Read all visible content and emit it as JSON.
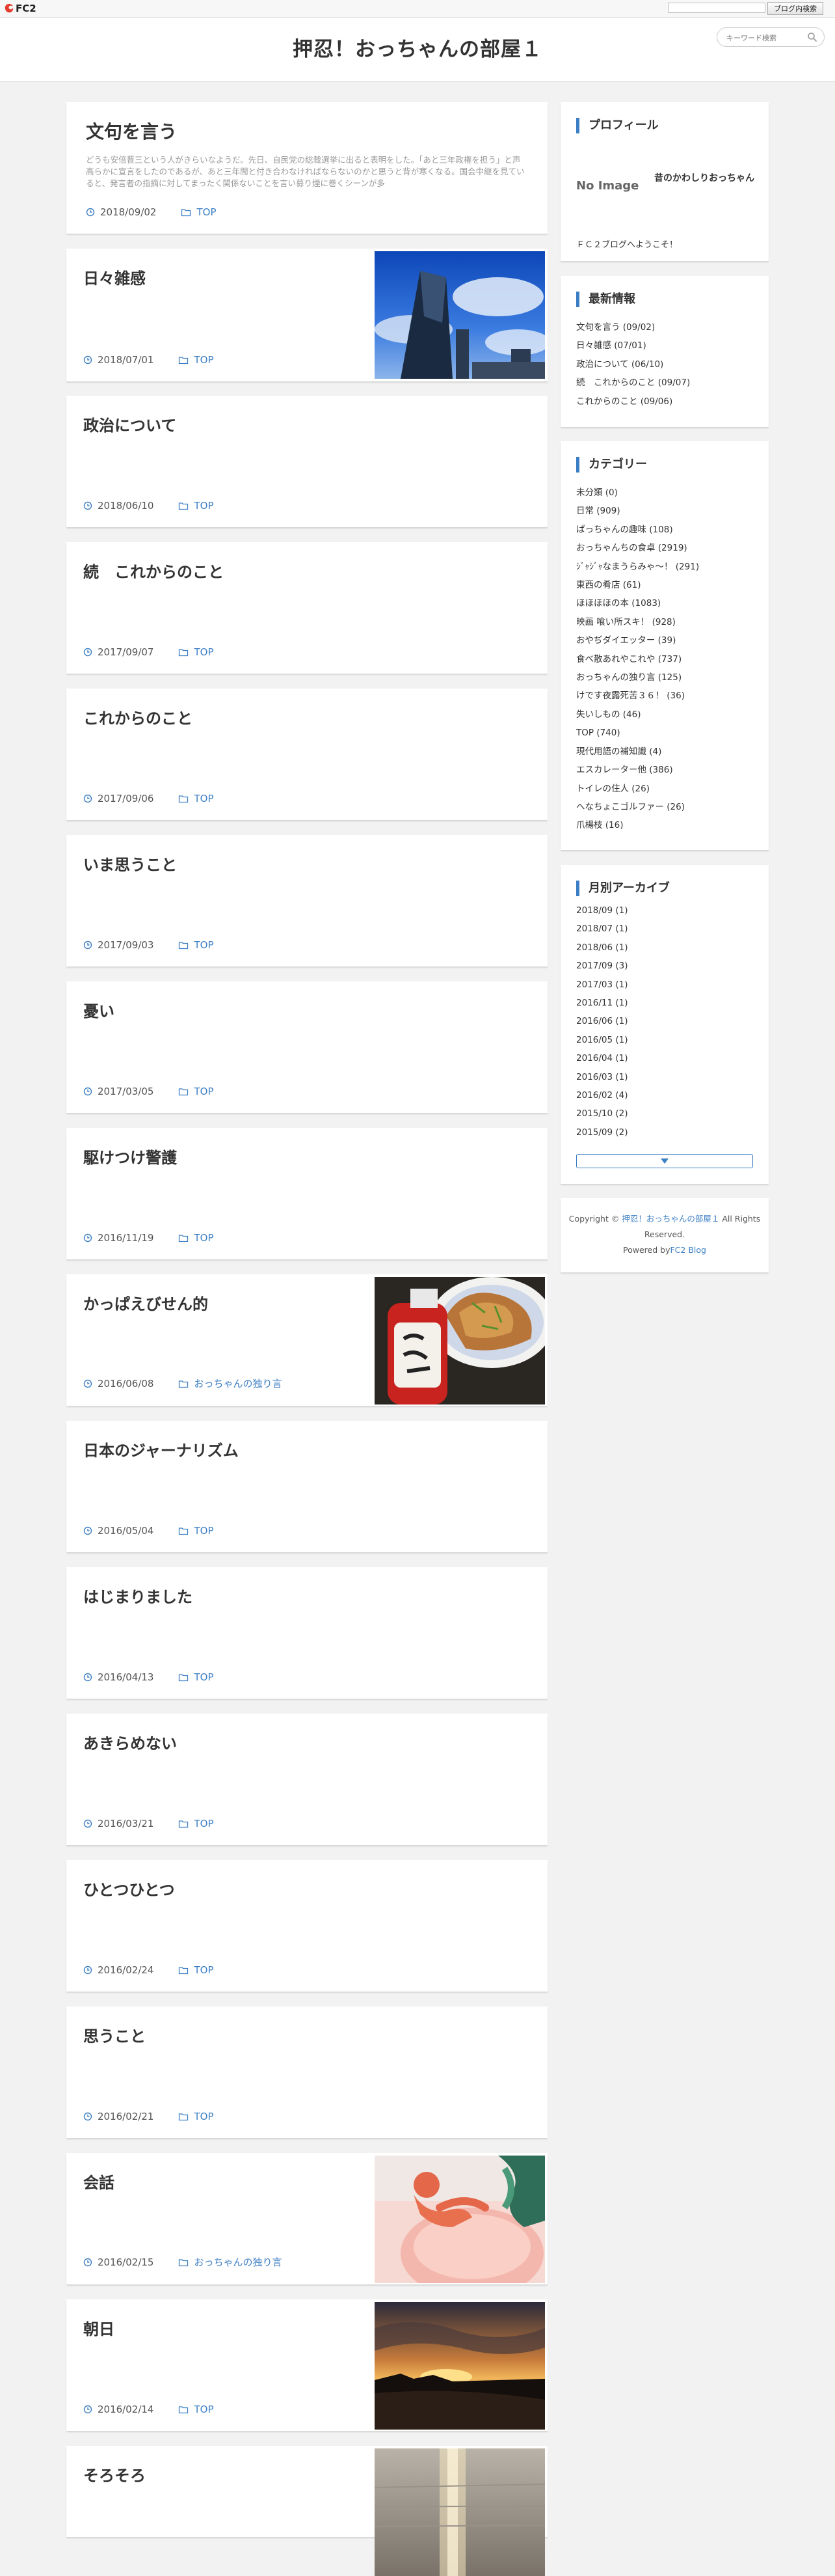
{
  "fc2bar": {
    "logo_text": "FC2",
    "search_button": "ブログ内検索"
  },
  "header": {
    "site_title": "押忍！おっちゃんの部屋１",
    "search_placeholder": "キーワード検索"
  },
  "featured_post": {
    "title": "文句を言う",
    "excerpt": "どうも安倍晋三という人がきらいなようだ。先日、自民党の総裁選挙に出ると表明をした。「あと三年政権を担う」と声高らかに宣言をしたのであるが、あと三年間と付き合わなければならないのかと思うと背が寒くなる。国会中継を見ていると、発言者の指摘に対してまったく関係ないことを言い募り煙に巻くシーンが多",
    "date": "2018/09/02",
    "category": "TOP"
  },
  "posts": [
    {
      "title": "日々雑感",
      "date": "2018/07/01",
      "category": "TOP"
    },
    {
      "title": "政治について",
      "date": "2018/06/10",
      "category": "TOP"
    },
    {
      "title": "続　これからのこと",
      "date": "2017/09/07",
      "category": "TOP"
    },
    {
      "title": "これからのこと",
      "date": "2017/09/06",
      "category": "TOP"
    },
    {
      "title": "いま思うこと",
      "date": "2017/09/03",
      "category": "TOP"
    },
    {
      "title": "憂い",
      "date": "2017/03/05",
      "category": "TOP"
    },
    {
      "title": "駆けつけ警護",
      "date": "2016/11/19",
      "category": "TOP"
    },
    {
      "title": "かっぱえびせん的",
      "date": "2016/06/08",
      "category": "おっちゃんの独り言"
    },
    {
      "title": "日本のジャーナリズム",
      "date": "2016/05/04",
      "category": "TOP"
    },
    {
      "title": "はじまりました",
      "date": "2016/04/13",
      "category": "TOP"
    },
    {
      "title": "あきらめない",
      "date": "2016/03/21",
      "category": "TOP"
    },
    {
      "title": "ひとつひとつ",
      "date": "2016/02/24",
      "category": "TOP"
    },
    {
      "title": "思うこと",
      "date": "2016/02/21",
      "category": "TOP"
    },
    {
      "title": "会話",
      "date": "2016/02/15",
      "category": "おっちゃんの独り言"
    },
    {
      "title": "朝日",
      "date": "2016/02/14",
      "category": "TOP"
    },
    {
      "title": "そろそろ",
      "date": "",
      "category": ""
    }
  ],
  "profile": {
    "title": "プロフィール",
    "no_image": "No Image",
    "name": "昔のかわしりおっちゃん",
    "welcome": "ＦＣ２ブログへようこそ！"
  },
  "recent": {
    "title": "最新情報",
    "items": [
      "文句を言う (09/02)",
      "日々雑感 (07/01)",
      "政治について (06/10)",
      "続　これからのこと (09/07)",
      "これからのこと (09/06)"
    ]
  },
  "categories": {
    "title": "カテゴリー",
    "items": [
      "未分類 (0)",
      "日常 (909)",
      "ぱっちゃんの趣味 (108)",
      "おっちゃんちの食卓 (2919)",
      "ｼﾞｬｼﾞｬなまうらみゃ〜！ (291)",
      "東西の肴店 (61)",
      "ほほほほの本 (1083)",
      "映画 喰い所スキ！ (928)",
      "おやぢダイエッター (39)",
      "食べ散あれやこれや (737)",
      "おっちゃんの独り言 (125)",
      "けです夜露死苦３６！ (36)",
      "失いしもの (46)",
      "TOP (740)",
      "現代用語の補知識 (4)",
      "エスカレーター他 (386)",
      "トイレの住人 (26)",
      "へなちょこゴルファー (26)",
      "爪楊枝 (16)"
    ]
  },
  "archives": {
    "title": "月別アーカイブ",
    "items": [
      "2018/09 (1)",
      "2018/07 (1)",
      "2018/06 (1)",
      "2017/09 (3)",
      "2017/03 (1)",
      "2016/11 (1)",
      "2016/06 (1)",
      "2016/05 (1)",
      "2016/04 (1)",
      "2016/03 (1)",
      "2016/02 (4)",
      "2015/10 (2)",
      "2015/09 (2)"
    ]
  },
  "footer": {
    "copyright_prefix": "Copyright ©",
    "site_link": "押忍！おっちゃんの部屋１",
    "rights": "All Rights Reserved.",
    "powered_prefix": "Powered by",
    "powered_link": "FC2 Blog"
  },
  "colors": {
    "accent": "#3d7fc4",
    "background": "#f2f2f2"
  }
}
